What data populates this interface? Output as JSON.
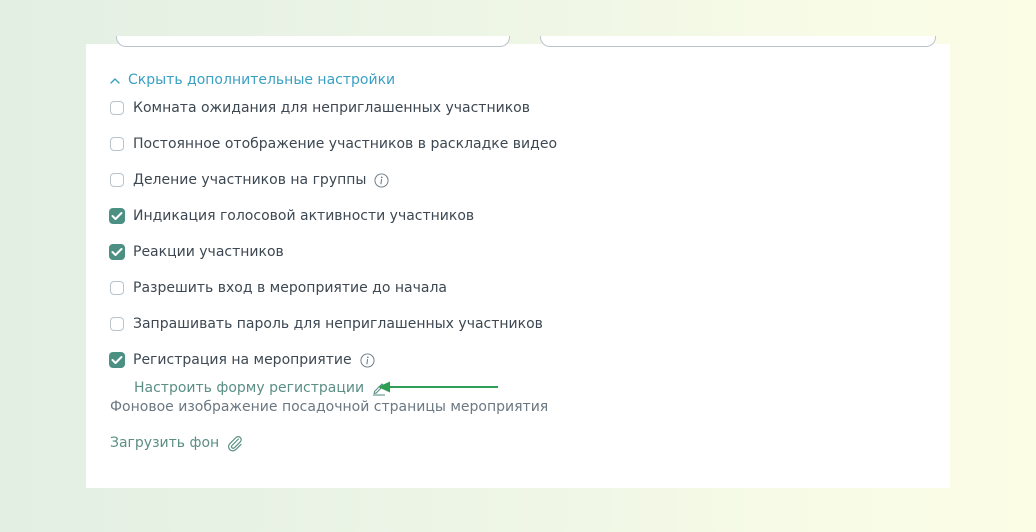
{
  "advanced": {
    "toggle_label": "Скрыть дополнительные настройки"
  },
  "options": [
    {
      "label": "Комната ожидания для неприглашенных участников",
      "checked": false,
      "info": false
    },
    {
      "label": "Постоянное отображение участников в раскладке видео",
      "checked": false,
      "info": false
    },
    {
      "label": "Деление участников на группы",
      "checked": false,
      "info": true
    },
    {
      "label": "Индикация голосовой активности участников",
      "checked": true,
      "info": false
    },
    {
      "label": "Реакции участников",
      "checked": true,
      "info": false
    },
    {
      "label": "Разрешить вход в мероприятие до начала",
      "checked": false,
      "info": false
    },
    {
      "label": "Запрашивать пароль для неприглашенных участников",
      "checked": false,
      "info": false
    },
    {
      "label": "Регистрация на мероприятие",
      "checked": true,
      "info": true
    }
  ],
  "registration": {
    "configure_link": "Настроить форму регистрации"
  },
  "background": {
    "title": "Фоновое изображение посадочной страницы мероприятия",
    "upload_link": "Загрузить фон"
  },
  "colors": {
    "accent_blue": "#3aa0c3",
    "checkbox_checked": "#4c8f83",
    "link_green": "#5b8f84",
    "arrow_green": "#2e9e55",
    "text": "#3d4852"
  },
  "icons": {
    "toggle": "chevron-up-icon",
    "info": "info-icon",
    "edit": "pencil-icon",
    "attach": "paperclip-icon",
    "annotation": "arrow-left-icon"
  }
}
